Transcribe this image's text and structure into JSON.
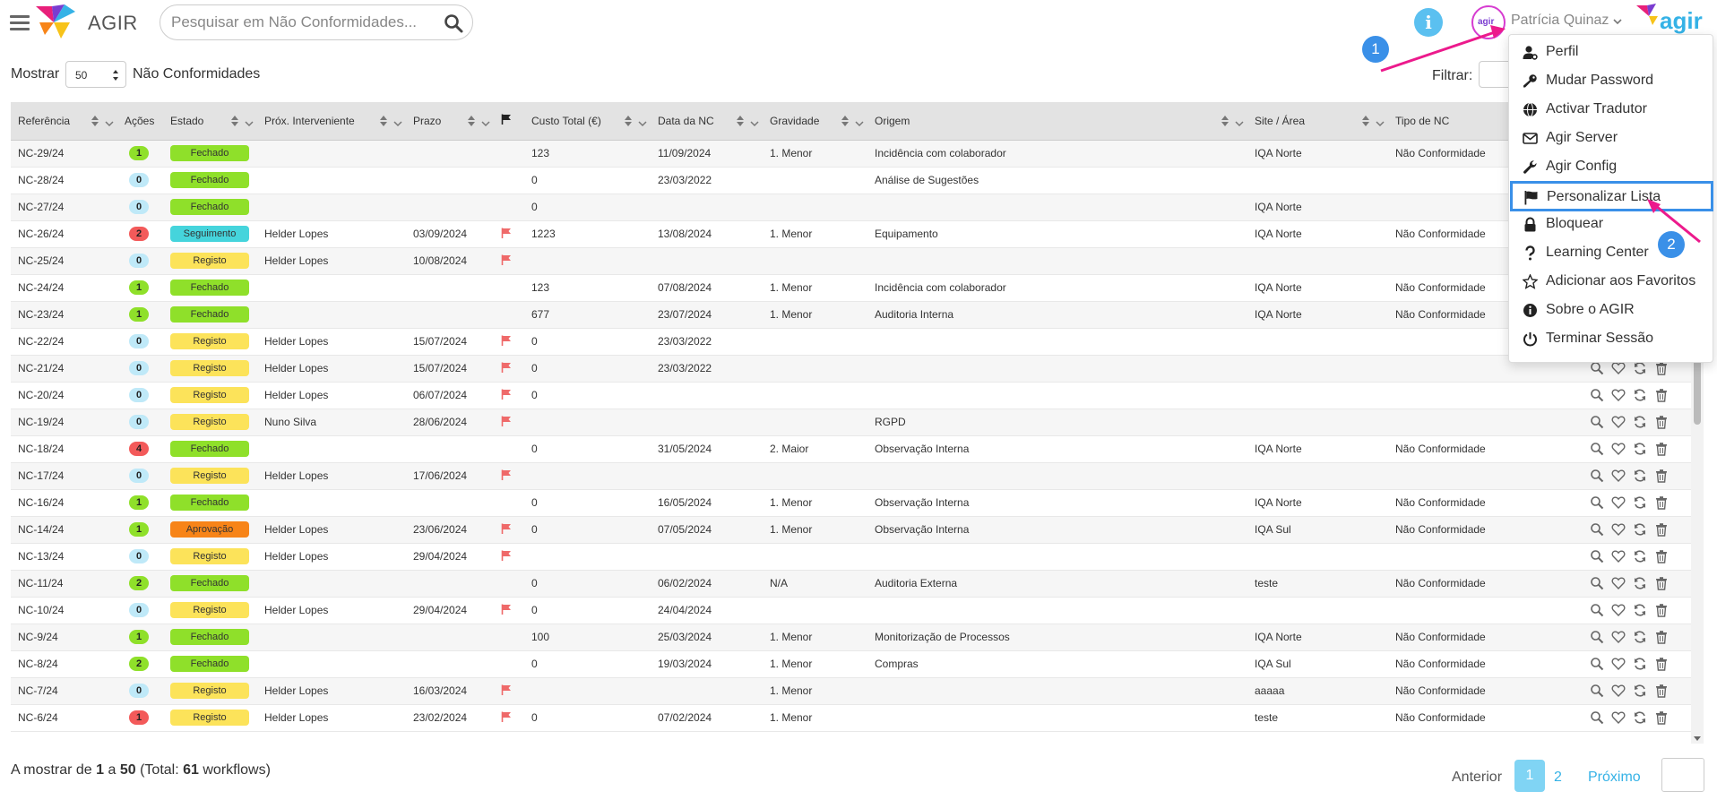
{
  "app": {
    "name": "AGIR",
    "search_placeholder": "Pesquisar em Não Conformidades...",
    "user_name": "Patrícia Quinaz",
    "avatar_text": "agir"
  },
  "controls": {
    "show_label": "Mostrar",
    "page_size": "50",
    "show_suffix": "Não Conformidades",
    "filter_label": "Filtrar:"
  },
  "table": {
    "columns": [
      "Referência",
      "Ações",
      "Estado",
      "Próx. Interveniente",
      "Prazo",
      "flag-icon",
      "Custo Total (€)",
      "Data da NC",
      "Gravidade",
      "Origem",
      "Site / Área",
      "Tipo de NC"
    ],
    "rows": [
      {
        "ref": "NC-29/24",
        "acoes": "1",
        "acoes_color": "#8fe02a",
        "estado": "Fechado",
        "estado_color": "#8fe02a",
        "interveniente": "",
        "prazo": "",
        "flag": false,
        "custo": "123",
        "data": "11/09/2024",
        "gravidade": "1. Menor",
        "origem": "Incidência com colaborador",
        "site": "IQA Norte",
        "tipo": "Não Conformidade"
      },
      {
        "ref": "NC-28/24",
        "acoes": "0",
        "acoes_color": "#bfe9f8",
        "estado": "Fechado",
        "estado_color": "#8fe02a",
        "interveniente": "",
        "prazo": "",
        "flag": false,
        "custo": "0",
        "data": "23/03/2022",
        "gravidade": "",
        "origem": "Análise de Sugestões",
        "site": "",
        "tipo": ""
      },
      {
        "ref": "NC-27/24",
        "acoes": "0",
        "acoes_color": "#bfe9f8",
        "estado": "Fechado",
        "estado_color": "#8fe02a",
        "interveniente": "",
        "prazo": "",
        "flag": false,
        "custo": "0",
        "data": "",
        "gravidade": "",
        "origem": "",
        "site": "IQA Norte",
        "tipo": ""
      },
      {
        "ref": "NC-26/24",
        "acoes": "2",
        "acoes_color": "#f35a5a",
        "estado": "Seguimento",
        "estado_color": "#45d4dc",
        "interveniente": "Helder Lopes",
        "prazo": "03/09/2024",
        "flag": true,
        "custo": "1223",
        "data": "13/08/2024",
        "gravidade": "1. Menor",
        "origem": "Equipamento",
        "site": "IQA Norte",
        "tipo": "Não Conformidade"
      },
      {
        "ref": "NC-25/24",
        "acoes": "0",
        "acoes_color": "#bfe9f8",
        "estado": "Registo",
        "estado_color": "#fce35a",
        "interveniente": "Helder Lopes",
        "prazo": "10/08/2024",
        "flag": true,
        "custo": "",
        "data": "",
        "gravidade": "",
        "origem": "",
        "site": "",
        "tipo": ""
      },
      {
        "ref": "NC-24/24",
        "acoes": "1",
        "acoes_color": "#8fe02a",
        "estado": "Fechado",
        "estado_color": "#8fe02a",
        "interveniente": "",
        "prazo": "",
        "flag": false,
        "custo": "123",
        "data": "07/08/2024",
        "gravidade": "1. Menor",
        "origem": "Incidência com colaborador",
        "site": "IQA Norte",
        "tipo": "Não Conformidade"
      },
      {
        "ref": "NC-23/24",
        "acoes": "1",
        "acoes_color": "#8fe02a",
        "estado": "Fechado",
        "estado_color": "#8fe02a",
        "interveniente": "",
        "prazo": "",
        "flag": false,
        "custo": "677",
        "data": "23/07/2024",
        "gravidade": "1. Menor",
        "origem": "Auditoria Interna",
        "site": "IQA Norte",
        "tipo": "Não Conformidade"
      },
      {
        "ref": "NC-22/24",
        "acoes": "0",
        "acoes_color": "#bfe9f8",
        "estado": "Registo",
        "estado_color": "#fce35a",
        "interveniente": "Helder Lopes",
        "prazo": "15/07/2024",
        "flag": true,
        "custo": "0",
        "data": "23/03/2022",
        "gravidade": "",
        "origem": "",
        "site": "",
        "tipo": ""
      },
      {
        "ref": "NC-21/24",
        "acoes": "0",
        "acoes_color": "#bfe9f8",
        "estado": "Registo",
        "estado_color": "#fce35a",
        "interveniente": "Helder Lopes",
        "prazo": "15/07/2024",
        "flag": true,
        "custo": "0",
        "data": "23/03/2022",
        "gravidade": "",
        "origem": "",
        "site": "",
        "tipo": ""
      },
      {
        "ref": "NC-20/24",
        "acoes": "0",
        "acoes_color": "#bfe9f8",
        "estado": "Registo",
        "estado_color": "#fce35a",
        "interveniente": "Helder Lopes",
        "prazo": "06/07/2024",
        "flag": true,
        "custo": "0",
        "data": "",
        "gravidade": "",
        "origem": "",
        "site": "",
        "tipo": ""
      },
      {
        "ref": "NC-19/24",
        "acoes": "0",
        "acoes_color": "#bfe9f8",
        "estado": "Registo",
        "estado_color": "#fce35a",
        "interveniente": "Nuno Silva",
        "prazo": "28/06/2024",
        "flag": true,
        "custo": "",
        "data": "",
        "gravidade": "",
        "origem": "RGPD",
        "site": "",
        "tipo": ""
      },
      {
        "ref": "NC-18/24",
        "acoes": "4",
        "acoes_color": "#f35a5a",
        "estado": "Fechado",
        "estado_color": "#8fe02a",
        "interveniente": "",
        "prazo": "",
        "flag": false,
        "custo": "0",
        "data": "31/05/2024",
        "gravidade": "2. Maior",
        "origem": "Observação Interna",
        "site": "IQA Norte",
        "tipo": "Não Conformidade"
      },
      {
        "ref": "NC-17/24",
        "acoes": "0",
        "acoes_color": "#bfe9f8",
        "estado": "Registo",
        "estado_color": "#fce35a",
        "interveniente": "Helder Lopes",
        "prazo": "17/06/2024",
        "flag": true,
        "custo": "",
        "data": "",
        "gravidade": "",
        "origem": "",
        "site": "",
        "tipo": ""
      },
      {
        "ref": "NC-16/24",
        "acoes": "1",
        "acoes_color": "#8fe02a",
        "estado": "Fechado",
        "estado_color": "#8fe02a",
        "interveniente": "",
        "prazo": "",
        "flag": false,
        "custo": "0",
        "data": "16/05/2024",
        "gravidade": "1. Menor",
        "origem": "Observação Interna",
        "site": "IQA Norte",
        "tipo": "Não Conformidade"
      },
      {
        "ref": "NC-14/24",
        "acoes": "1",
        "acoes_color": "#8fe02a",
        "estado": "Aprovação",
        "estado_color": "#f78418",
        "interveniente": "Helder Lopes",
        "prazo": "23/06/2024",
        "flag": true,
        "custo": "0",
        "data": "07/05/2024",
        "gravidade": "1. Menor",
        "origem": "Observação Interna",
        "site": "IQA Sul",
        "tipo": "Não Conformidade"
      },
      {
        "ref": "NC-13/24",
        "acoes": "0",
        "acoes_color": "#bfe9f8",
        "estado": "Registo",
        "estado_color": "#fce35a",
        "interveniente": "Helder Lopes",
        "prazo": "29/04/2024",
        "flag": true,
        "custo": "",
        "data": "",
        "gravidade": "",
        "origem": "",
        "site": "",
        "tipo": ""
      },
      {
        "ref": "NC-11/24",
        "acoes": "2",
        "acoes_color": "#8fe02a",
        "estado": "Fechado",
        "estado_color": "#8fe02a",
        "interveniente": "",
        "prazo": "",
        "flag": false,
        "custo": "0",
        "data": "06/02/2024",
        "gravidade": "N/A",
        "origem": "Auditoria Externa",
        "site": "teste",
        "tipo": "Não Conformidade"
      },
      {
        "ref": "NC-10/24",
        "acoes": "0",
        "acoes_color": "#bfe9f8",
        "estado": "Registo",
        "estado_color": "#fce35a",
        "interveniente": "Helder Lopes",
        "prazo": "29/04/2024",
        "flag": true,
        "custo": "0",
        "data": "24/04/2024",
        "gravidade": "",
        "origem": "",
        "site": "",
        "tipo": ""
      },
      {
        "ref": "NC-9/24",
        "acoes": "1",
        "acoes_color": "#8fe02a",
        "estado": "Fechado",
        "estado_color": "#8fe02a",
        "interveniente": "",
        "prazo": "",
        "flag": false,
        "custo": "100",
        "data": "25/03/2024",
        "gravidade": "1. Menor",
        "origem": "Monitorização de Processos",
        "site": "IQA Norte",
        "tipo": "Não Conformidade"
      },
      {
        "ref": "NC-8/24",
        "acoes": "2",
        "acoes_color": "#8fe02a",
        "estado": "Fechado",
        "estado_color": "#8fe02a",
        "interveniente": "",
        "prazo": "",
        "flag": false,
        "custo": "0",
        "data": "19/03/2024",
        "gravidade": "1. Menor",
        "origem": "Compras",
        "site": "IQA Sul",
        "tipo": "Não Conformidade"
      },
      {
        "ref": "NC-7/24",
        "acoes": "0",
        "acoes_color": "#bfe9f8",
        "estado": "Registo",
        "estado_color": "#fce35a",
        "interveniente": "Helder Lopes",
        "prazo": "16/03/2024",
        "flag": true,
        "custo": "",
        "data": "",
        "gravidade": "1. Menor",
        "origem": "",
        "site": "aaaaa",
        "tipo": "Não Conformidade"
      },
      {
        "ref": "NC-6/24",
        "acoes": "1",
        "acoes_color": "#f35a5a",
        "estado": "Registo",
        "estado_color": "#fce35a",
        "interveniente": "Helder Lopes",
        "prazo": "23/02/2024",
        "flag": true,
        "custo": "0",
        "data": "07/02/2024",
        "gravidade": "1. Menor",
        "origem": "",
        "site": "teste",
        "tipo": "Não Conformidade"
      }
    ]
  },
  "footer": {
    "summary_prefix": "A mostrar de ",
    "summary_from": "1",
    "summary_mid": " a ",
    "summary_to": "50",
    "summary_total_prefix": " (Total: ",
    "summary_total": "61",
    "summary_suffix": " workflows)",
    "prev": "Anterior",
    "page1": "1",
    "page2": "2",
    "next": "Próximo"
  },
  "user_menu": [
    {
      "icon": "user-gear-icon",
      "label": "Perfil"
    },
    {
      "icon": "key-icon",
      "label": "Mudar Password"
    },
    {
      "icon": "globe-icon",
      "label": "Activar Tradutor"
    },
    {
      "icon": "envelope-icon",
      "label": "Agir Server"
    },
    {
      "icon": "wrench-icon",
      "label": "Agir Config"
    },
    {
      "icon": "flag-icon",
      "label": "Personalizar Lista",
      "highlighted": true
    },
    {
      "icon": "lock-icon",
      "label": "Bloquear"
    },
    {
      "icon": "question-icon",
      "label": "Learning Center"
    },
    {
      "icon": "star-icon",
      "label": "Adicionar aos Favoritos"
    },
    {
      "icon": "info-icon",
      "label": "Sobre o AGIR"
    },
    {
      "icon": "power-icon",
      "label": "Terminar Sessão"
    }
  ],
  "annotations": {
    "step1": "1",
    "step2": "2"
  }
}
